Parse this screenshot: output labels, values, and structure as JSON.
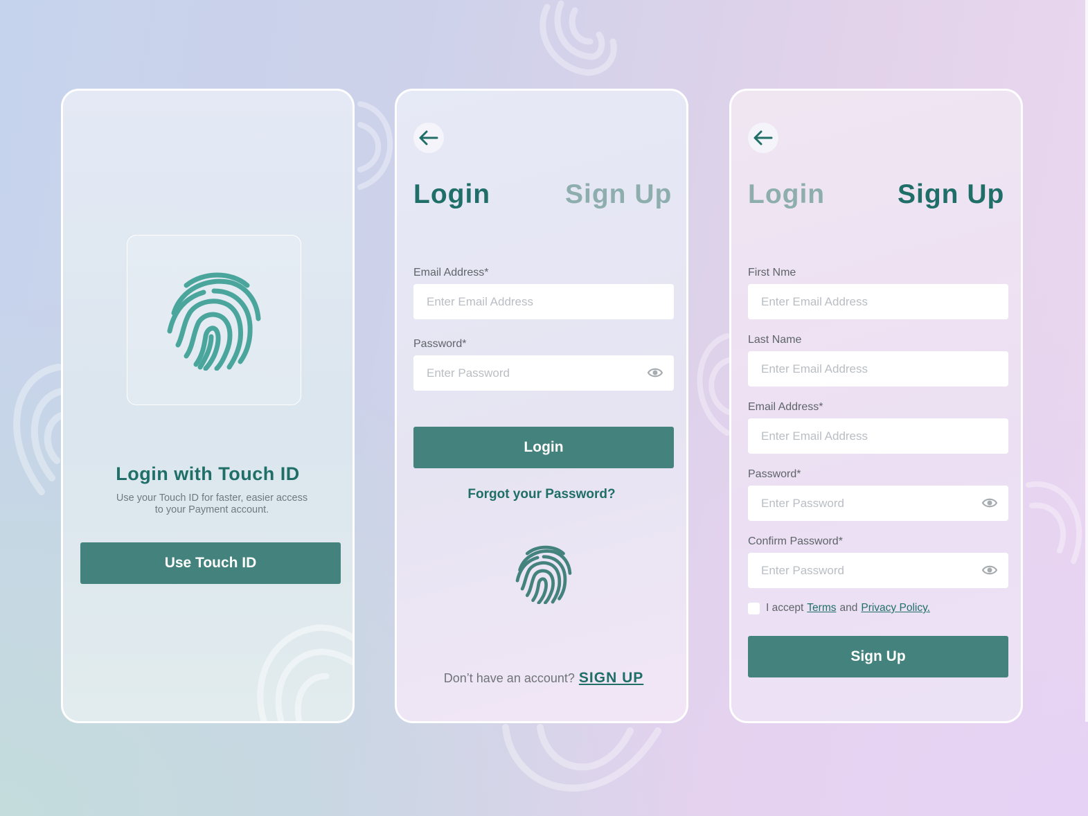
{
  "colors": {
    "primary": "#43827d",
    "primary_text": "#1f6e67",
    "inactive_tab": "#8eaeae",
    "fingerprint": "#4aa69c"
  },
  "touch_card": {
    "icon": "fingerprint-icon",
    "title": "Login with Touch ID",
    "subtitle": "Use your Touch ID for faster, easier access to your Payment account.",
    "button": "Use Touch ID"
  },
  "login_card": {
    "back_icon": "arrow-left-icon",
    "tabs": {
      "login": "Login",
      "signup": "Sign Up",
      "active": "login"
    },
    "email": {
      "label": "Email Address*",
      "placeholder": "Enter Email Address"
    },
    "password": {
      "label": "Password*",
      "placeholder": "Enter Password",
      "icon": "eye-icon"
    },
    "button": "Login",
    "forgot": "Forgot your Password?",
    "fingerprint_icon": "fingerprint-icon",
    "no_account": "Don’t have an account?",
    "signup_link": "SIGN UP"
  },
  "signup_card": {
    "back_icon": "arrow-left-icon",
    "tabs": {
      "login": "Login",
      "signup": "Sign Up",
      "active": "signup"
    },
    "first_name": {
      "label": "First Nme",
      "placeholder": "Enter Email Address"
    },
    "last_name": {
      "label": "Last Name",
      "placeholder": "Enter Email Address"
    },
    "email": {
      "label": "Email Address*",
      "placeholder": "Enter Email Address"
    },
    "password": {
      "label": "Password*",
      "placeholder": "Enter Password",
      "icon": "eye-icon"
    },
    "confirm_password": {
      "label": "Confirm Password*",
      "placeholder": "Enter Password",
      "icon": "eye-icon"
    },
    "terms": {
      "prefix": "I accept",
      "terms_link": "Terms",
      "and": "and",
      "privacy_link": "Privacy Policy.",
      "checked": false
    },
    "button": "Sign Up"
  }
}
